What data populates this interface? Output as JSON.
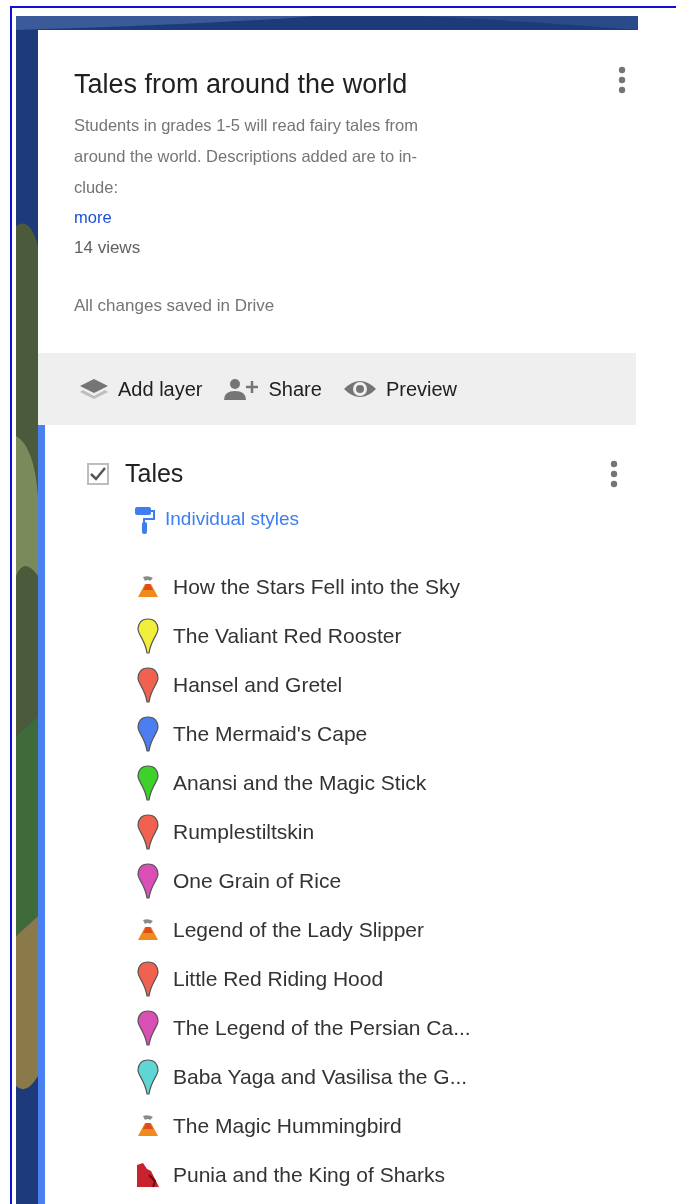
{
  "map": {
    "title": "Tales from around the world",
    "description_lines": [
      "Students in grades 1-5 will read fairy tales from",
      "around the world. Descriptions added are to in-",
      "clude:"
    ],
    "more_link": "more",
    "views": "14 views",
    "save_status": "All changes saved in Drive"
  },
  "toolbar": [
    {
      "kind": "layers",
      "label": "Add layer"
    },
    {
      "kind": "share",
      "label": "Share"
    },
    {
      "kind": "preview",
      "label": "Preview"
    }
  ],
  "layer": {
    "name": "Tales",
    "checked": true,
    "selected": true,
    "style_label": "Individual styles",
    "items": [
      {
        "kind": "volcano",
        "label": "How the Stars Fell into the Sky"
      },
      {
        "kind": "pin",
        "color": "#f2ee3c",
        "label": "The Valiant Red Rooster"
      },
      {
        "kind": "pin",
        "color": "#f0614f",
        "label": "Hansel and Gretel"
      },
      {
        "kind": "pin",
        "color": "#4d7ef0",
        "label": "The Mermaid's Cape"
      },
      {
        "kind": "pin",
        "color": "#3ed12a",
        "label": "Anansi and the Magic Stick"
      },
      {
        "kind": "pin",
        "color": "#f0614f",
        "label": "Rumplestiltskin"
      },
      {
        "kind": "pin",
        "color": "#d94fb5",
        "label": "One Grain of Rice"
      },
      {
        "kind": "volcano",
        "label": "Legend of the Lady Slipper"
      },
      {
        "kind": "pin",
        "color": "#f0614f",
        "label": "Little Red Riding Hood"
      },
      {
        "kind": "pin",
        "color": "#d94fb5",
        "label": "The Legend of the Persian Ca..."
      },
      {
        "kind": "pin",
        "color": "#5fd6d4",
        "label": "Baba Yaga and Vasilisa the G..."
      },
      {
        "kind": "volcano",
        "label": "The Magic Hummingbird"
      },
      {
        "kind": "cliff",
        "label": "Punia and the King of Sharks"
      }
    ]
  }
}
